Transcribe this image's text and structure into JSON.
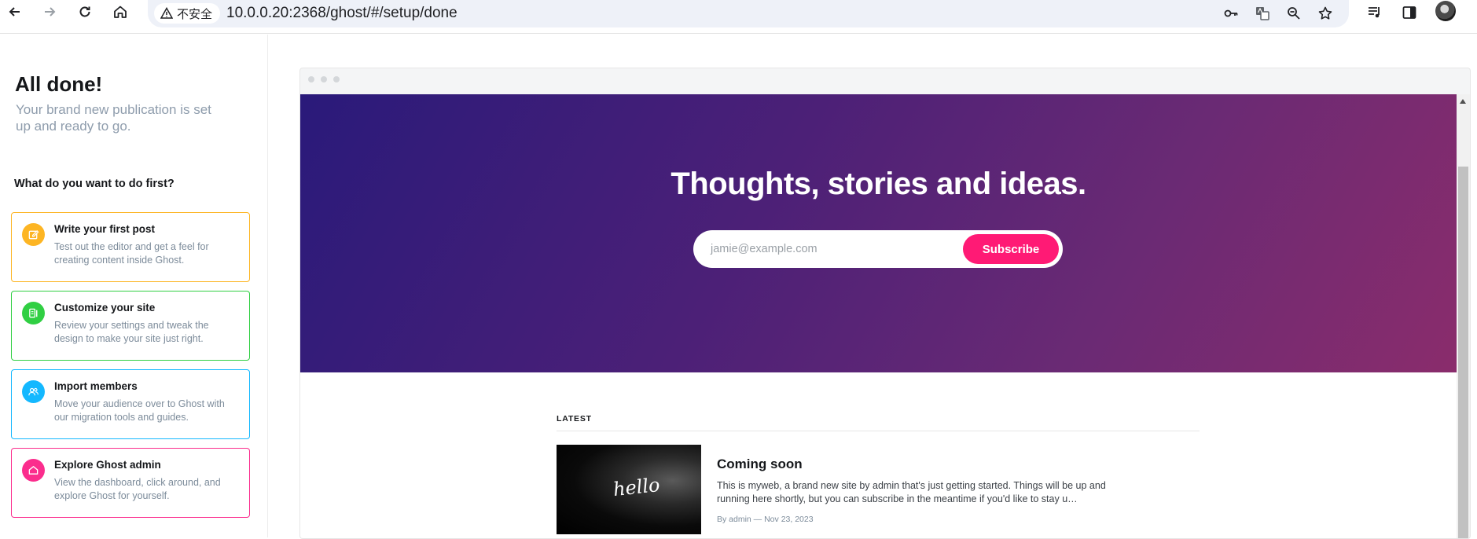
{
  "browser": {
    "security_label": "不安全",
    "url": "10.0.0.20:2368/ghost/#/setup/done"
  },
  "setup": {
    "title": "All done!",
    "subtitle": "Your brand new publication is set up and ready to go.",
    "question": "What do you want to do first?",
    "cards": [
      {
        "title": "Write your first post",
        "desc": "Test out the editor and get a feel for creating content inside Ghost.",
        "color": "#fdb523",
        "icon": "pencil-icon"
      },
      {
        "title": "Customize your site",
        "desc": "Review your settings and tweak the design to make your site just right.",
        "color": "#30cf43",
        "icon": "paintbrush-icon"
      },
      {
        "title": "Import members",
        "desc": "Move your audience over to Ghost with our migration tools and guides.",
        "color": "#14b8ff",
        "icon": "members-icon"
      },
      {
        "title": "Explore Ghost admin",
        "desc": "View the dashboard, click around, and explore Ghost for yourself.",
        "color": "#fb2d8d",
        "icon": "home-icon"
      }
    ]
  },
  "site": {
    "hero_title": "Thoughts, stories and ideas.",
    "email_placeholder": "jamie@example.com",
    "subscribe_label": "Subscribe",
    "accent": "#ff1a75",
    "latest_label": "LATEST",
    "post": {
      "image_text": "hello",
      "title": "Coming soon",
      "excerpt": "This is myweb, a brand new site by admin that's just getting started. Things will be up and running here shortly, but you can subscribe in the meantime if you'd like to stay u…",
      "meta": "By admin — Nov 23, 2023"
    }
  }
}
